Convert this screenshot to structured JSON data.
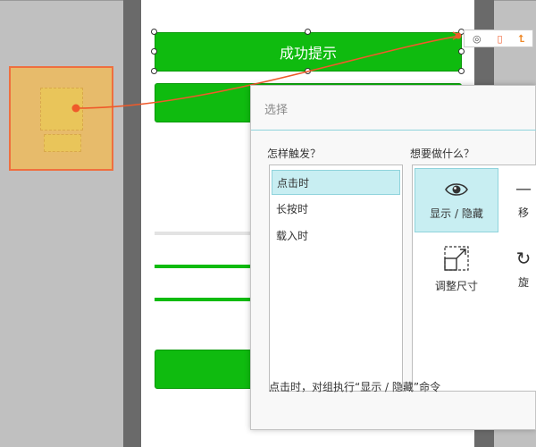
{
  "canvas": {
    "widget_buttons": {
      "button1_label": "成功提示",
      "button2_label": "",
      "button3_label": ""
    },
    "mini_toolbar": {
      "icons": [
        "target-icon",
        "page-icon",
        "arrow-up-icon"
      ]
    }
  },
  "dialog": {
    "title": "选择",
    "trigger_section_label": "怎样触发？",
    "action_section_label": "想要做什么？",
    "triggers": [
      {
        "label": "点击时",
        "selected": true
      },
      {
        "label": "长按时",
        "selected": false
      },
      {
        "label": "载入时",
        "selected": false
      }
    ],
    "actions": [
      {
        "label": "显示 / 隐藏",
        "icon": "eye-icon",
        "selected": true
      },
      {
        "label": "移",
        "icon": "move-icon",
        "selected": false
      },
      {
        "label": "调整尺寸",
        "icon": "resize-icon",
        "selected": false
      },
      {
        "label": "旋",
        "icon": "rotate-icon",
        "selected": false
      }
    ],
    "status_text": "点击时，对组执行“显示 / 隐藏”命令"
  },
  "colors": {
    "green": "#0fbb0f",
    "accent_orange": "#ef5a2a",
    "selection_teal": "#c8eef2"
  }
}
